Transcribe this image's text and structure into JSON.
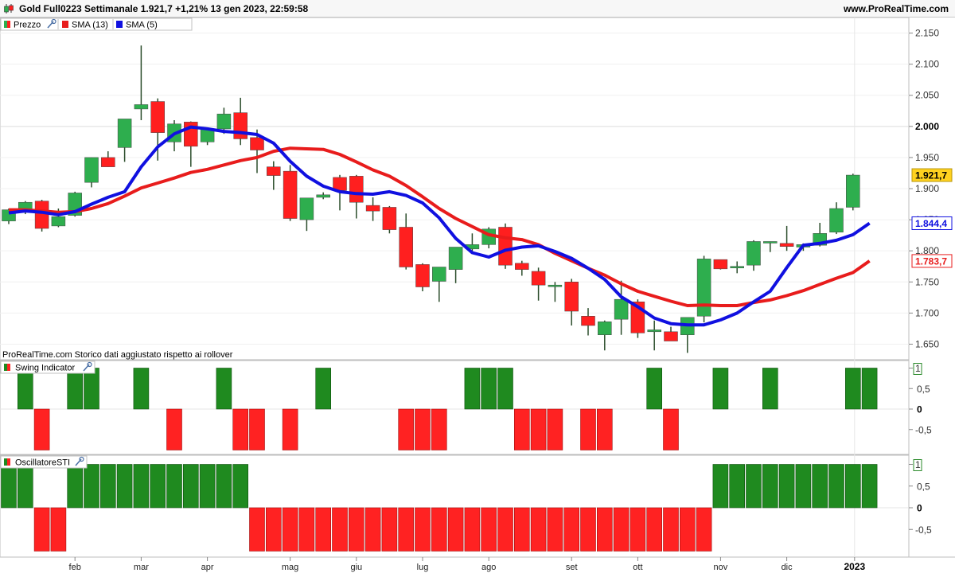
{
  "header": {
    "title": "Gold Full0223 Settimanale 1.921,7 +1,21% 13 gen 2023, 22:59:58",
    "site": "www.ProRealTime.com"
  },
  "legend": {
    "price": "Prezzo",
    "sma13": "SMA (13)",
    "sma5": "SMA (5)",
    "footnote": "ProRealTime.com Storico dati aggiustato rispetto ai rollover",
    "swing": "Swing Indicator",
    "osc": "OscillatoreSTI"
  },
  "colors": {
    "up": "#2eae4e",
    "down": "#ff1f1f",
    "sma13": "#e81c1c",
    "sma5": "#1010e0",
    "bar_green": "#1f8a1f",
    "bar_red": "#ff2222"
  },
  "chart_data": [
    {
      "type": "candlestick",
      "title": "Gold Full0223 Settimanale",
      "x_month_labels": [
        "feb",
        "mar",
        "apr",
        "mag",
        "giu",
        "lug",
        "ago",
        "set",
        "ott",
        "nov",
        "dic",
        "2023"
      ],
      "ylim": [
        1625,
        2175
      ],
      "yticks": [
        1650,
        1700,
        1750,
        1800,
        1850,
        1900,
        1950,
        2000,
        2050,
        2100,
        2150
      ],
      "ytick_labels": [
        "1.650",
        "1.700",
        "1.750",
        "1.800",
        "1.850",
        "1.900",
        "1.950",
        "2.000",
        "2.050",
        "2.100",
        "2.150"
      ],
      "last_price_label": "1.921,7",
      "sma5_label": "1.844,4",
      "sma13_label": "1.783,7",
      "ohlc": [
        [
          1848,
          1868,
          1843,
          1866
        ],
        [
          1866,
          1880,
          1859,
          1878
        ],
        [
          1880,
          1882,
          1831,
          1836
        ],
        [
          1840,
          1868,
          1838,
          1855
        ],
        [
          1857,
          1895,
          1855,
          1893
        ],
        [
          1910,
          1950,
          1902,
          1950
        ],
        [
          1950,
          1960,
          1935,
          1935
        ],
        [
          1966,
          2002,
          1943,
          2012
        ],
        [
          2028,
          2130,
          2010,
          2035
        ],
        [
          2040,
          2045,
          1945,
          1990
        ],
        [
          1975,
          2010,
          1960,
          2004
        ],
        [
          2007,
          2008,
          1935,
          1968
        ],
        [
          1975,
          1995,
          1970,
          1995
        ],
        [
          1996,
          2030,
          1988,
          2020
        ],
        [
          2022,
          2046,
          1970,
          1980
        ],
        [
          1982,
          1995,
          1925,
          1962
        ],
        [
          1935,
          1944,
          1898,
          1921
        ],
        [
          1928,
          1938,
          1848,
          1852
        ],
        [
          1850,
          1880,
          1832,
          1885
        ],
        [
          1886,
          1894,
          1883,
          1890
        ],
        [
          1918,
          1922,
          1865,
          1897
        ],
        [
          1920,
          1922,
          1852,
          1878
        ],
        [
          1873,
          1886,
          1848,
          1864
        ],
        [
          1870,
          1872,
          1828,
          1834
        ],
        [
          1838,
          1860,
          1770,
          1774
        ],
        [
          1778,
          1780,
          1735,
          1742
        ],
        [
          1751,
          1774,
          1718,
          1774
        ],
        [
          1770,
          1806,
          1748,
          1806
        ],
        [
          1803,
          1828,
          1796,
          1810
        ],
        [
          1810,
          1838,
          1804,
          1835
        ],
        [
          1838,
          1844,
          1771,
          1777
        ],
        [
          1780,
          1784,
          1760,
          1770
        ],
        [
          1767,
          1773,
          1720,
          1745
        ],
        [
          1743,
          1750,
          1718,
          1745
        ],
        [
          1750,
          1755,
          1680,
          1703
        ],
        [
          1695,
          1708,
          1664,
          1680
        ],
        [
          1665,
          1688,
          1640,
          1686
        ],
        [
          1690,
          1752,
          1665,
          1722
        ],
        [
          1718,
          1722,
          1660,
          1668
        ],
        [
          1670,
          1688,
          1640,
          1673
        ],
        [
          1670,
          1678,
          1660,
          1655
        ],
        [
          1665,
          1691,
          1636,
          1693
        ],
        [
          1695,
          1792,
          1685,
          1787
        ],
        [
          1786,
          1782,
          1770,
          1771
        ],
        [
          1775,
          1783,
          1764,
          1775
        ],
        [
          1777,
          1817,
          1768,
          1815
        ],
        [
          1813,
          1815,
          1798,
          1815
        ],
        [
          1812,
          1840,
          1800,
          1807
        ],
        [
          1806,
          1812,
          1800,
          1810
        ],
        [
          1809,
          1845,
          1807,
          1828
        ],
        [
          1830,
          1878,
          1827,
          1868
        ],
        [
          1870,
          1924,
          1865,
          1921.7
        ]
      ],
      "sma13": [
        1866,
        1866,
        1864,
        1862,
        1863,
        1868,
        1876,
        1888,
        1901,
        1909,
        1917,
        1926,
        1931,
        1938,
        1945,
        1950,
        1960,
        1965,
        1964,
        1963,
        1955,
        1943,
        1930,
        1920,
        1905,
        1887,
        1868,
        1852,
        1839,
        1826,
        1821,
        1818,
        1810,
        1796,
        1784,
        1772,
        1761,
        1747,
        1735,
        1727,
        1719,
        1712,
        1713,
        1712,
        1712,
        1717,
        1721,
        1728,
        1736,
        1746,
        1756,
        1765,
        1783.7
      ],
      "sma5": [
        1861,
        1864,
        1862,
        1858,
        1863,
        1875,
        1886,
        1895,
        1935,
        1967,
        1988,
        1999,
        1996,
        1992,
        1990,
        1987,
        1973,
        1944,
        1920,
        1904,
        1895,
        1892,
        1891,
        1895,
        1889,
        1877,
        1853,
        1820,
        1797,
        1790,
        1801,
        1806,
        1808,
        1799,
        1788,
        1772,
        1754,
        1726,
        1710,
        1692,
        1683,
        1681,
        1681,
        1689,
        1700,
        1718,
        1735,
        1773,
        1809,
        1812,
        1817,
        1826,
        1844.4
      ]
    },
    {
      "type": "bar",
      "title": "Swing Indicator",
      "ylim": [
        -1,
        1
      ],
      "ytick_labels": [
        "1",
        "0,5",
        "0",
        "-0,5"
      ],
      "values": [
        0,
        1,
        -1,
        0,
        1,
        1,
        0,
        0,
        1,
        0,
        -1,
        0,
        0,
        1,
        -1,
        -1,
        0,
        -1,
        0,
        1,
        0,
        0,
        0,
        0,
        -1,
        -1,
        -1,
        0,
        1,
        1,
        1,
        -1,
        -1,
        -1,
        0,
        -1,
        -1,
        0,
        0,
        1,
        -1,
        0,
        0,
        1,
        0,
        0,
        1,
        0,
        0,
        0,
        0,
        1,
        1
      ]
    },
    {
      "type": "bar",
      "title": "OscillatoreSTI",
      "ylim": [
        -1,
        1
      ],
      "ytick_labels": [
        "1",
        "0,5",
        "0",
        "-0,5"
      ],
      "values": [
        1,
        1,
        -1,
        -1,
        1,
        1,
        1,
        1,
        1,
        1,
        1,
        1,
        1,
        1,
        1,
        -1,
        -1,
        -1,
        -1,
        -1,
        -1,
        -1,
        -1,
        -1,
        -1,
        -1,
        -1,
        -1,
        -1,
        -1,
        -1,
        -1,
        -1,
        -1,
        -1,
        -1,
        -1,
        -1,
        -1,
        -1,
        -1,
        -1,
        -1,
        1,
        1,
        1,
        1,
        1,
        1,
        1,
        1,
        1,
        1
      ]
    }
  ]
}
